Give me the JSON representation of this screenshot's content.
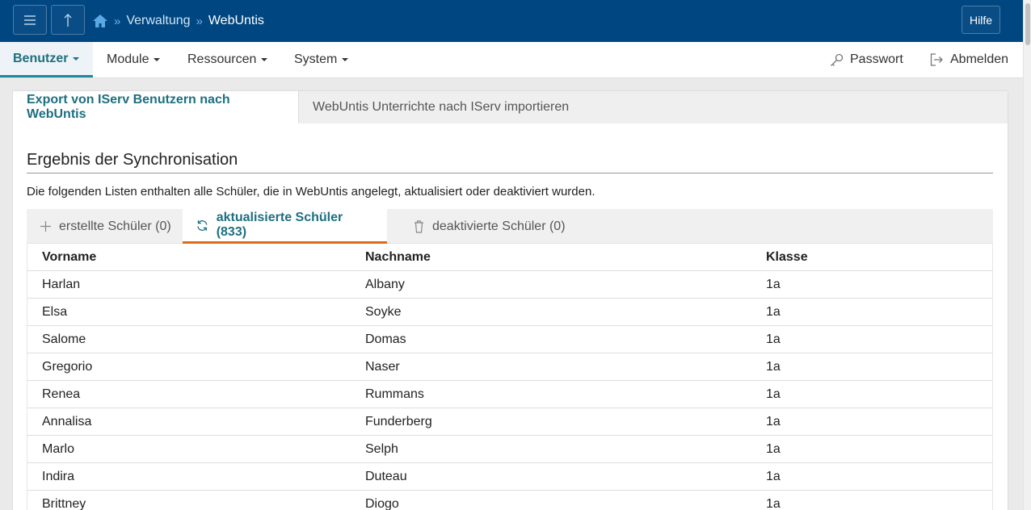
{
  "topbar": {
    "breadcrumb": [
      "Verwaltung",
      "WebUntis"
    ],
    "help_label": "Hilfe",
    "icons": [
      "menu-icon",
      "up-arrow-icon",
      "home-icon"
    ]
  },
  "nav": {
    "items": [
      "Benutzer",
      "Module",
      "Ressourcen",
      "System"
    ],
    "active": "Benutzer",
    "password_label": "Passwort",
    "logout_label": "Abmelden"
  },
  "panel": {
    "tabs": [
      "Export von IServ Benutzern nach WebUntis",
      "WebUntis Unterrichte nach IServ importieren"
    ],
    "title": "Ergebnis der Synchronisation",
    "description": "Die folgenden Listen enthalten alle Schüler, die in WebUntis angelegt, aktualisiert oder deaktiviert wurden.",
    "subtabs": [
      "erstellte Schüler (0)",
      "aktualisierte Schüler (833)",
      "deaktivierte Schüler (0)"
    ],
    "active_subtab": "aktualisierte Schüler (833)"
  },
  "table": {
    "headers": [
      "Vorname",
      "Nachname",
      "Klasse"
    ],
    "rows": [
      [
        "Harlan",
        "Albany",
        "1a"
      ],
      [
        "Elsa",
        "Soyke",
        "1a"
      ],
      [
        "Salome",
        "Domas",
        "1a"
      ],
      [
        "Gregorio",
        "Naser",
        "1a"
      ],
      [
        "Renea",
        "Rummans",
        "1a"
      ],
      [
        "Annalisa",
        "Funderberg",
        "1a"
      ],
      [
        "Marlo",
        "Selph",
        "1a"
      ],
      [
        "Indira",
        "Duteau",
        "1a"
      ],
      [
        "Brittney",
        "Diogo",
        "1a"
      ]
    ]
  },
  "colors": {
    "topbar": "#004680",
    "accent": "#1d6f80",
    "active_underline": "#e06a1a"
  }
}
